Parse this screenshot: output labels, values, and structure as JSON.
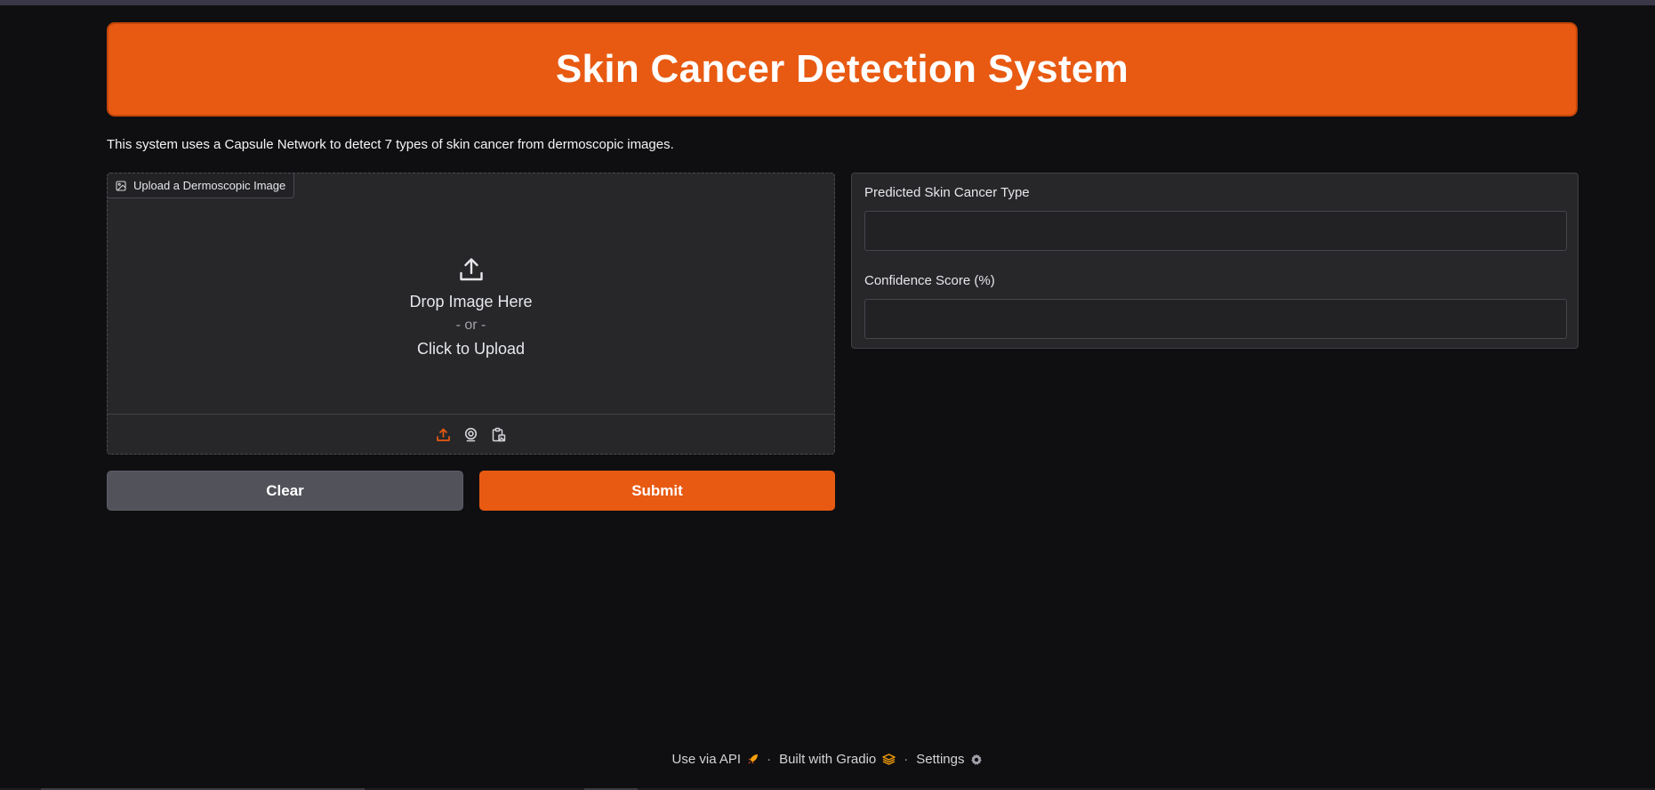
{
  "header": {
    "title": "Skin Cancer Detection System"
  },
  "description": "This system uses a Capsule Network to detect 7 types of skin cancer from dermoscopic images.",
  "upload": {
    "label": "Upload a Dermoscopic Image",
    "drop_text": "Drop Image Here",
    "or_text": "- or -",
    "click_text": "Click to Upload",
    "sources": [
      "upload-icon",
      "webcam-icon",
      "clipboard-icon"
    ]
  },
  "buttons": {
    "clear_label": "Clear",
    "submit_label": "Submit"
  },
  "outputs": {
    "prediction_label": "Predicted Skin Cancer Type",
    "prediction_value": "",
    "confidence_label": "Confidence Score (%)",
    "confidence_value": ""
  },
  "footer": {
    "api_label": "Use via API",
    "built_label": "Built with Gradio",
    "settings_label": "Settings"
  },
  "colors": {
    "accent": "#e85a12",
    "background": "#0f0f11",
    "panel": "#27272a",
    "secondary_button": "#52525b"
  }
}
